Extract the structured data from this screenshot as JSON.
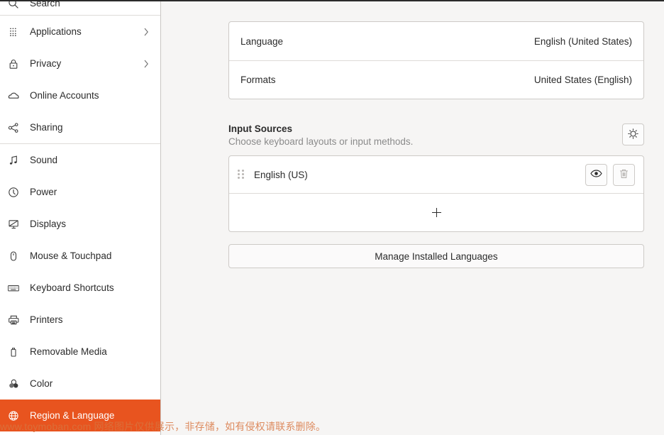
{
  "sidebar": {
    "items": [
      {
        "label": "Search",
        "icon": "search-icon",
        "key": "search",
        "chevron": false,
        "selected": false,
        "sep_after": true
      },
      {
        "label": "Applications",
        "icon": "grid-icon",
        "key": "applications",
        "chevron": true,
        "selected": false,
        "sep_after": false
      },
      {
        "label": "Privacy",
        "icon": "lock-icon",
        "key": "privacy",
        "chevron": true,
        "selected": false,
        "sep_after": false
      },
      {
        "label": "Online Accounts",
        "icon": "cloud-icon",
        "key": "online-accounts",
        "chevron": false,
        "selected": false,
        "sep_after": false
      },
      {
        "label": "Sharing",
        "icon": "share-icon",
        "key": "sharing",
        "chevron": false,
        "selected": false,
        "sep_after": true
      },
      {
        "label": "Sound",
        "icon": "music-note-icon",
        "key": "sound",
        "chevron": false,
        "selected": false,
        "sep_after": false
      },
      {
        "label": "Power",
        "icon": "power-icon",
        "key": "power",
        "chevron": false,
        "selected": false,
        "sep_after": false
      },
      {
        "label": "Displays",
        "icon": "display-icon",
        "key": "displays",
        "chevron": false,
        "selected": false,
        "sep_after": false
      },
      {
        "label": "Mouse & Touchpad",
        "icon": "mouse-icon",
        "key": "mouse-touchpad",
        "chevron": false,
        "selected": false,
        "sep_after": false
      },
      {
        "label": "Keyboard Shortcuts",
        "icon": "keyboard-icon",
        "key": "keyboard-shortcuts",
        "chevron": false,
        "selected": false,
        "sep_after": false
      },
      {
        "label": "Printers",
        "icon": "printer-icon",
        "key": "printers",
        "chevron": false,
        "selected": false,
        "sep_after": false
      },
      {
        "label": "Removable Media",
        "icon": "usb-drive-icon",
        "key": "removable-media",
        "chevron": false,
        "selected": false,
        "sep_after": false
      },
      {
        "label": "Color",
        "icon": "color-circles-icon",
        "key": "color",
        "chevron": false,
        "selected": false,
        "sep_after": false
      },
      {
        "label": "Region & Language",
        "icon": "globe-icon",
        "key": "region-language",
        "chevron": false,
        "selected": true,
        "sep_after": false
      }
    ]
  },
  "main": {
    "language_row": {
      "label": "Language",
      "value": "English (United States)"
    },
    "formats_row": {
      "label": "Formats",
      "value": "United States (English)"
    },
    "input_sources": {
      "title": "Input Sources",
      "subtitle": "Choose keyboard layouts or input methods.",
      "settings_icon": "gear-icon",
      "sources": [
        {
          "name": "English (US)",
          "preview_icon": "eye-icon",
          "remove_icon": "trash-icon",
          "remove_disabled": true
        }
      ],
      "add_icon": "plus-icon"
    },
    "manage_languages_button": "Manage Installed Languages"
  },
  "watermark": {
    "text": "www.toymoban.com 网络图片仅供展示，非存储，如有侵权请联系删除。"
  },
  "colors": {
    "accent": "#e8541f",
    "sidebar_bg": "#ffffff",
    "content_bg": "#f6f5f4",
    "card_bg": "#ffffff",
    "border": "#cdcac7",
    "text": "#2b2b2b",
    "muted_text": "#8b8b8b"
  }
}
